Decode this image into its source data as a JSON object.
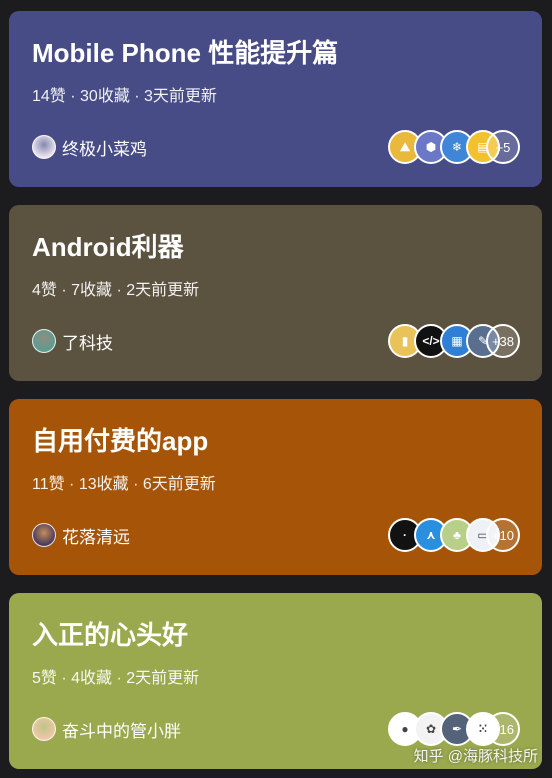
{
  "collections": [
    {
      "title": "Mobile Phone 性能提升篇",
      "meta": "14赞 · 30收藏 · 3天前更新",
      "author": "终极小菜鸡",
      "avatar_color": "#e9e4ee",
      "more_count": "+5",
      "bg": "#474c87",
      "app_icons": [
        {
          "name": "mountain-app-icon",
          "color": "#e8b93a",
          "glyph": "⛰"
        },
        {
          "name": "hexagon-app-icon",
          "color": "#6b78c8",
          "glyph": "⬢"
        },
        {
          "name": "snowflake-app-icon",
          "color": "#3f86d8",
          "glyph": "❄"
        },
        {
          "name": "note-app-icon",
          "color": "#f2c12e",
          "glyph": "▤"
        }
      ]
    },
    {
      "title": "Android利器",
      "meta": "4赞 · 7收藏 · 2天前更新",
      "author": "了科技",
      "avatar_color": "#5b9e91",
      "more_count": "+38",
      "bg": "#5b5240",
      "app_icons": [
        {
          "name": "zip-app-icon",
          "color": "#e9c25a",
          "glyph": "▮"
        },
        {
          "name": "code-app-icon",
          "color": "#111111",
          "glyph": "</>"
        },
        {
          "name": "calendar-app-icon",
          "color": "#2f7fd6",
          "glyph": "▦"
        },
        {
          "name": "feather-app-icon",
          "color": "#5a6f8f",
          "glyph": "✎"
        }
      ]
    },
    {
      "title": "自用付费的app",
      "meta": "11赞 · 13收藏 · 6天前更新",
      "author": "花落清远",
      "avatar_color": "#4b3a5e",
      "more_count": "+10",
      "bg": "#a65407",
      "app_icons": [
        {
          "name": "dark-app-icon",
          "color": "#121212",
          "glyph": "·"
        },
        {
          "name": "share-tree-app-icon",
          "color": "#2b8fe0",
          "glyph": "⋏"
        },
        {
          "name": "plant-app-icon",
          "color": "#b8cf8a",
          "glyph": "♣"
        },
        {
          "name": "card-app-icon",
          "color": "#eef1f5",
          "glyph": "▭"
        }
      ]
    },
    {
      "title": "入正的心头好",
      "meta": "5赞 · 4收藏 · 2天前更新",
      "author": "奋斗中的管小胖",
      "avatar_color": "#f0c7a6",
      "more_count": "+16",
      "bg": "#9aa84e",
      "app_icons": [
        {
          "name": "tomato-app-icon",
          "color": "#ffffff",
          "glyph": "●"
        },
        {
          "name": "sketch-app-icon",
          "color": "#f3f3f3",
          "glyph": "✿"
        },
        {
          "name": "quill-app-icon",
          "color": "#54627a",
          "glyph": "✒"
        },
        {
          "name": "dots-app-icon",
          "color": "#ffffff",
          "glyph": "⁙"
        }
      ]
    }
  ],
  "watermark": "知乎 @海豚科技所"
}
